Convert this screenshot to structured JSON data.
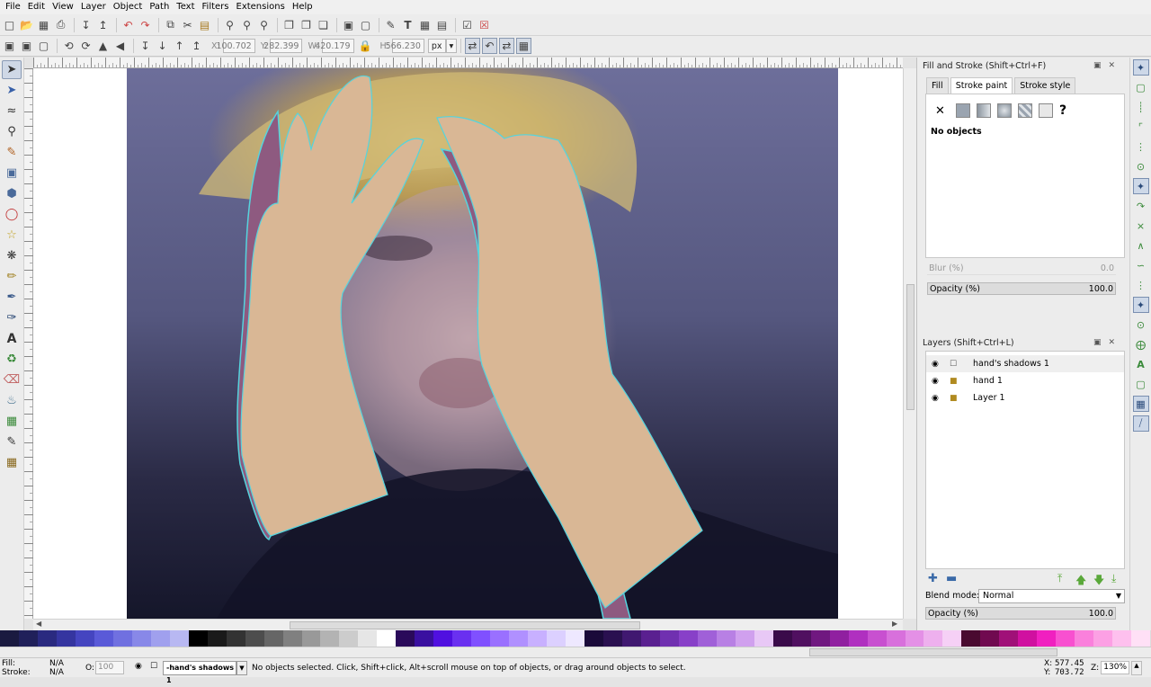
{
  "menu": [
    "File",
    "Edit",
    "View",
    "Layer",
    "Object",
    "Path",
    "Text",
    "Filters",
    "Extensions",
    "Help"
  ],
  "controls": {
    "x_label": "X:",
    "x_value": "100.702",
    "y_label": "Y:",
    "y_value": "282.399",
    "w_label": "W:",
    "w_value": "420.179",
    "h_label": "H:",
    "h_value": "566.230",
    "unit": "px"
  },
  "fill_stroke": {
    "title": "Fill and Stroke (Shift+Ctrl+F)",
    "tabs": [
      "Fill",
      "Stroke paint",
      "Stroke style"
    ],
    "no_objects": "No objects",
    "blur_label": "Blur (%)",
    "blur_value": "0.0",
    "opacity_label": "Opacity (%)",
    "opacity_value": "100.0"
  },
  "layers": {
    "title": "Layers (Shift+Ctrl+L)",
    "items": [
      "hand's shadows 1",
      "hand 1",
      "Layer 1"
    ],
    "blend_label": "Blend mode:",
    "blend_value": "Normal",
    "opacity_label": "Opacity (%)",
    "opacity_value": "100.0"
  },
  "status": {
    "fill_label": "Fill:",
    "fill_value": "N/A",
    "stroke_label": "Stroke:",
    "stroke_value": "N/A",
    "o_label": "O:",
    "o_value": "100",
    "current_layer": "-hand's shadows 1",
    "message": "No objects selected. Click, Shift+click, Alt+scroll mouse on top of objects, or drag around objects to select.",
    "x_label": "X:",
    "x_value": "577.45",
    "y_label": "Y:",
    "y_value": "703.72",
    "z_label": "Z:",
    "zoom": "130%"
  },
  "colors": {
    "skin": "#d9b795",
    "shadow": "#8e5a80",
    "outline": "#55d4de",
    "panel_bg": "#ececec"
  },
  "palette": [
    "#1a1a40",
    "#20205a",
    "#2a2a80",
    "#3535a0",
    "#4545c0",
    "#5a5ad8",
    "#7070e0",
    "#8888e8",
    "#a0a0ee",
    "#b8b8f2",
    "#000000",
    "#1a1a1a",
    "#333333",
    "#4d4d4d",
    "#666666",
    "#808080",
    "#999999",
    "#b3b3b3",
    "#cccccc",
    "#e6e6e6",
    "#ffffff",
    "#2a0a5a",
    "#3a10a0",
    "#5010e0",
    "#6a30f0",
    "#8050ff",
    "#9a70ff",
    "#b090ff",
    "#c8b0ff",
    "#dcd0ff",
    "#eee8ff",
    "#1a0a3a",
    "#2a1050",
    "#401870",
    "#5a2090",
    "#7030b0",
    "#8840c8",
    "#a060d8",
    "#b880e4",
    "#d0a0ee",
    "#e8c8f6",
    "#3a0a4a",
    "#501060",
    "#701880",
    "#9020a0",
    "#b030c0",
    "#c850d0",
    "#d870dc",
    "#e490e6",
    "#eeb0ee",
    "#f6d0f6",
    "#4a0a30",
    "#700a50",
    "#a01078",
    "#d010a0",
    "#f020c0",
    "#f850d0",
    "#fa80dc",
    "#fca0e4",
    "#fec0ee",
    "#ffe0f6"
  ]
}
